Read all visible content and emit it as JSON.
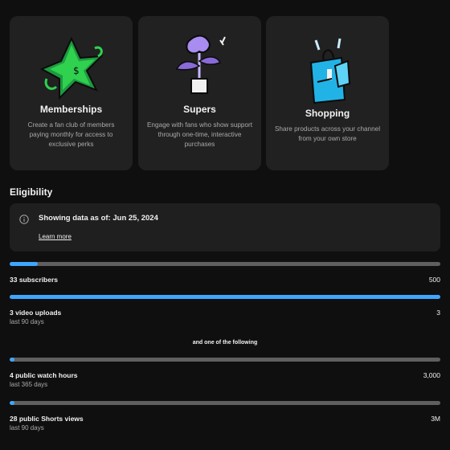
{
  "cards": [
    {
      "title": "Memberships",
      "desc": "Create a fan club of members paying monthly for access to exclusive perks",
      "icon": "star-badge-icon"
    },
    {
      "title": "Supers",
      "desc": "Engage with fans who show support through one-time, interactive purchases",
      "icon": "potted-plant-icon"
    },
    {
      "title": "Shopping",
      "desc": "Share products across your channel from your own store",
      "icon": "shopping-bag-icon"
    }
  ],
  "eligibility": {
    "title": "Eligibility",
    "notice": "Showing data as of: Jun 25, 2024",
    "learn_more": "Learn more",
    "separator": "and one of the following",
    "requirements": [
      {
        "label": "33 subscribers",
        "target": "500",
        "sub": "",
        "progress": 0.066
      },
      {
        "label": "3 video uploads",
        "target": "3",
        "sub": "last 90 days",
        "progress": 1.0
      },
      {
        "label": "4 public watch hours",
        "target": "3,000",
        "sub": "last 365 days",
        "progress": 0.0013
      },
      {
        "label": "28 public Shorts views",
        "target": "3M",
        "sub": "last 90 days",
        "progress": 1e-05
      }
    ]
  },
  "colors": {
    "accent": "#3ea6ff",
    "track": "#5f5f5f",
    "card": "#212121",
    "background": "#0f0f0f"
  }
}
